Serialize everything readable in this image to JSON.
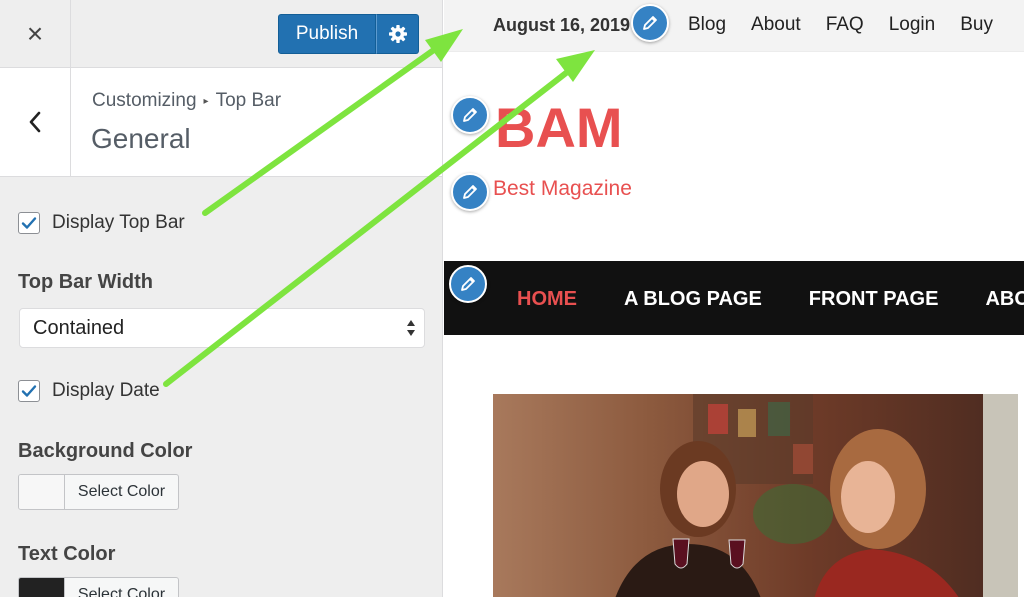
{
  "header": {
    "close_label": "×",
    "publish_label": "Publish"
  },
  "section": {
    "breadcrumb_root": "Customizing",
    "breadcrumb_separator": "▸",
    "breadcrumb_current": "Top Bar",
    "title": "General"
  },
  "controls": {
    "display_top_bar": {
      "label": "Display Top Bar",
      "checked": true
    },
    "top_bar_width": {
      "title": "Top Bar Width",
      "selected": "Contained"
    },
    "display_date": {
      "label": "Display Date",
      "checked": true
    },
    "background_color": {
      "title": "Background Color",
      "button_label": "Select Color",
      "swatch": "#f7f7f7"
    },
    "text_color": {
      "title": "Text Color",
      "button_label": "Select Color",
      "swatch": "#222222"
    }
  },
  "preview": {
    "date": "August 16, 2019",
    "topbar_menu": [
      "Blog",
      "About",
      "FAQ",
      "Login",
      "Buy"
    ],
    "site_title": "BAM",
    "tagline": "Best Magazine",
    "nav": [
      "HOME",
      "A BLOG PAGE",
      "FRONT PAGE",
      "ABOUT"
    ]
  },
  "colors": {
    "accent": "#2271b1",
    "brand_red": "#e85050",
    "annotation_arrow": "#7ee43f",
    "edit_pencil": "#3582c4"
  },
  "icons": {
    "close": "close-icon",
    "gear": "gear-icon",
    "back": "chevron-left-icon",
    "check": "checkmark-icon",
    "edit": "pencil-icon"
  }
}
